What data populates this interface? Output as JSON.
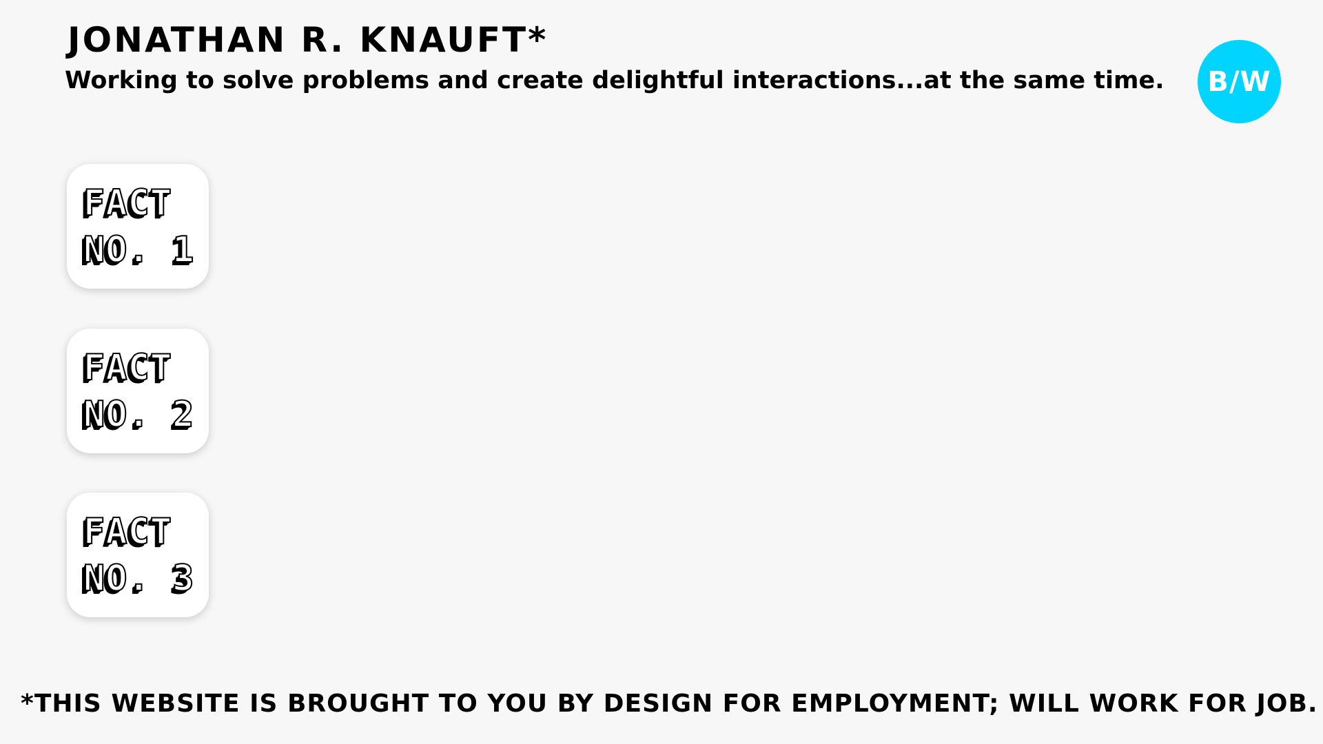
{
  "header": {
    "title": "Jonathan R. Knauft*",
    "tagline": "Working to solve problems and create delightful interactions...at the same time."
  },
  "theme_toggle": {
    "label": "B/W",
    "color": "#00d4ff"
  },
  "facts": [
    {
      "line1": "FACT",
      "line2": "NO. 1"
    },
    {
      "line1": "FACT",
      "line2": "NO. 2"
    },
    {
      "line1": "FACT",
      "line2": "NO. 3"
    }
  ],
  "footer": {
    "note": "*This website is brought to you by design for employment; will work for job."
  },
  "colors": {
    "background": "#f7f7f7",
    "card": "#ffffff",
    "accent": "#00d4ff",
    "text": "#000000"
  }
}
